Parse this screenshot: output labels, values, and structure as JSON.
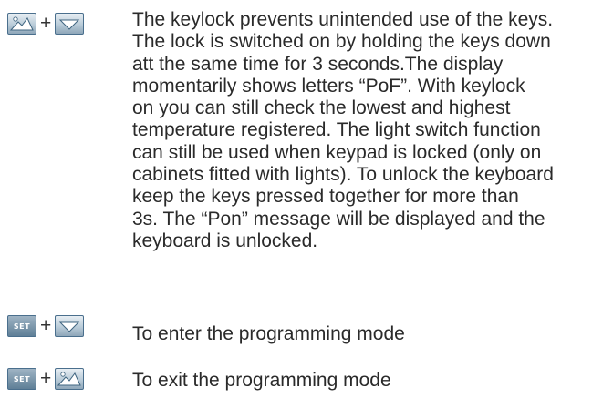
{
  "instructions": [
    {
      "id": "keylock",
      "keys": [
        "mountain-up-key",
        "down-arrow-key"
      ],
      "separator": "+",
      "text": "The keylock prevents unintended use of the keys.\nThe lock is switched on by holding the keys down\natt the same time for 3 seconds.The display\nmomentarily shows letters “PoF”. With keylock\non you can still check the lowest and highest\ntemperature registered. The light switch function\ncan still be used when keypad is locked (only on\ncabinets fitted with lights). To unlock the keyboard\nkeep the keys pressed together for more than\n3s. The “Pon” message will be displayed and the\nkeyboard is unlocked."
    },
    {
      "id": "enter-programming",
      "keys": [
        "set-key",
        "down-arrow-key"
      ],
      "separator": "+",
      "set_label": "SET",
      "text": "To enter the programming mode"
    },
    {
      "id": "exit-programming",
      "keys": [
        "set-key",
        "mountain-up-key"
      ],
      "separator": "+",
      "set_label": "SET",
      "text": "To exit the programming mode"
    }
  ],
  "colors": {
    "key_border": "#4a6f8d",
    "text": "#2a2a2a"
  }
}
